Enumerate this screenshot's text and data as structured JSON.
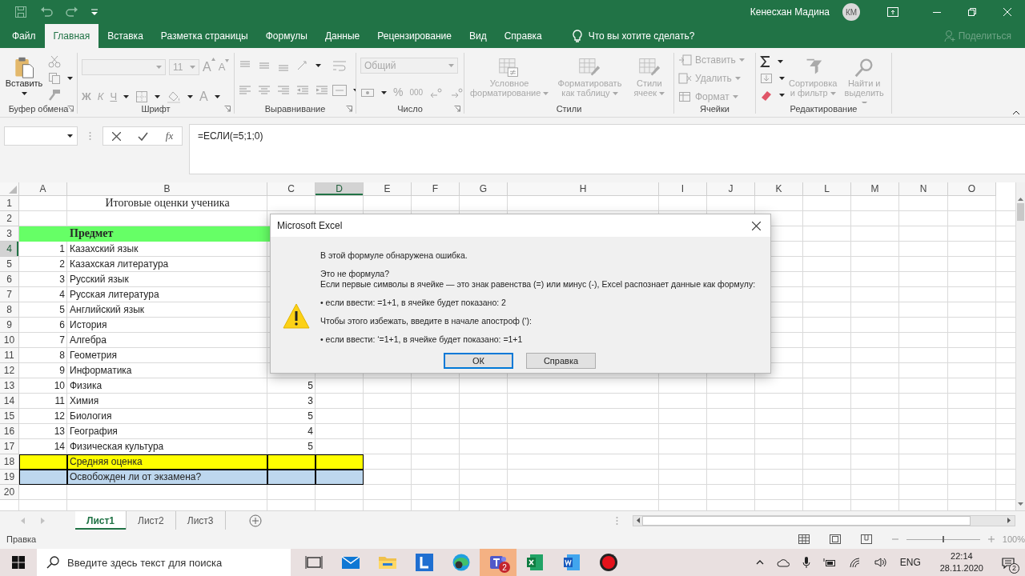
{
  "title_bar": {
    "user_name": "Кенесхан Мадина",
    "avatar": "КМ"
  },
  "ribbon_tabs": [
    {
      "label": "Файл",
      "selected": false
    },
    {
      "label": "Главная",
      "selected": true
    },
    {
      "label": "Вставка",
      "selected": false
    },
    {
      "label": "Разметка страницы",
      "selected": false
    },
    {
      "label": "Формулы",
      "selected": false
    },
    {
      "label": "Данные",
      "selected": false
    },
    {
      "label": "Рецензирование",
      "selected": false
    },
    {
      "label": "Вид",
      "selected": false
    },
    {
      "label": "Справка",
      "selected": false
    }
  ],
  "tell_me": "Что вы хотите сделать?",
  "share": {
    "label": "Поделиться",
    "disabled": true
  },
  "ribbon": {
    "clipboard": {
      "label": "Буфер обмена",
      "paste": {
        "label": "Вставить",
        "disabled": false
      }
    },
    "font": {
      "label": "Шрифт",
      "size": "11",
      "grow": "A",
      "shrink": "A",
      "styles": [
        "Ж",
        "К",
        "Ч"
      ],
      "font_color": "A"
    },
    "alignment": {
      "label": "Выравнивание"
    },
    "number": {
      "label": "Число",
      "format": "Общий",
      "percent": "%",
      "thousands": "000"
    },
    "styles": {
      "label": "Стили",
      "buttons": [
        {
          "label": "Условное форматирование",
          "disabled": true
        },
        {
          "label": "Форматировать как таблицу",
          "disabled": true
        },
        {
          "label": "Стили ячеек",
          "disabled": true
        }
      ]
    },
    "cells": {
      "label": "Ячейки",
      "buttons": [
        {
          "label": "Вставить",
          "disabled": true
        },
        {
          "label": "Удалить",
          "disabled": true
        },
        {
          "label": "Формат",
          "disabled": true
        }
      ]
    },
    "editing": {
      "label": "Редактирование",
      "buttons": [
        {
          "label": "Сортировка и фильтр",
          "disabled": true
        },
        {
          "label": "Найти и выделить",
          "disabled": true
        }
      ]
    }
  },
  "formula_bar": {
    "fx": "fx",
    "formula": "=ЕСЛИ(=5;1;0)"
  },
  "sheet": {
    "columns": [
      {
        "label": "A",
        "selected": false
      },
      {
        "label": "B",
        "selected": false
      },
      {
        "label": "C",
        "selected": false
      },
      {
        "label": "D",
        "selected": true
      },
      {
        "label": "E",
        "selected": false
      },
      {
        "label": "F",
        "selected": false
      },
      {
        "label": "G",
        "selected": false
      },
      {
        "label": "H",
        "selected": false
      },
      {
        "label": "I",
        "selected": false
      },
      {
        "label": "J",
        "selected": false
      },
      {
        "label": "K",
        "selected": false
      },
      {
        "label": "L",
        "selected": false
      },
      {
        "label": "M",
        "selected": false
      },
      {
        "label": "N",
        "selected": false
      },
      {
        "label": "O",
        "selected": false
      }
    ],
    "rows": [
      {
        "header": "1",
        "selected": false,
        "kind": "title",
        "cells": [
          "",
          "Итоговые оценки ученика"
        ]
      },
      {
        "header": "2",
        "selected": false,
        "kind": "item",
        "cells": []
      },
      {
        "header": "3",
        "selected": false,
        "kind": "heading",
        "color": "#66ff66",
        "cells": [
          "",
          "Предмет"
        ]
      },
      {
        "header": "4",
        "selected": true,
        "kind": "item",
        "cells": [
          "1",
          "Казахский язык"
        ]
      },
      {
        "header": "5",
        "selected": false,
        "kind": "item",
        "cells": [
          "2",
          "Казахская литература"
        ]
      },
      {
        "header": "6",
        "selected": false,
        "kind": "item",
        "cells": [
          "3",
          "Русский язык"
        ]
      },
      {
        "header": "7",
        "selected": false,
        "kind": "item",
        "cells": [
          "4",
          "Русская литература"
        ]
      },
      {
        "header": "8",
        "selected": false,
        "kind": "item",
        "cells": [
          "5",
          "Английский язык"
        ]
      },
      {
        "header": "9",
        "selected": false,
        "kind": "item",
        "cells": [
          "6",
          "История"
        ]
      },
      {
        "header": "10",
        "selected": false,
        "kind": "item",
        "cells": [
          "7",
          "Алгебра"
        ]
      },
      {
        "header": "11",
        "selected": false,
        "kind": "item",
        "cells": [
          "8",
          "Геометрия"
        ]
      },
      {
        "header": "12",
        "selected": false,
        "kind": "item",
        "cells": [
          "9",
          "Информатика"
        ]
      },
      {
        "header": "13",
        "selected": false,
        "kind": "item",
        "cells": [
          "10",
          "Физика",
          "5"
        ]
      },
      {
        "header": "14",
        "selected": false,
        "kind": "item",
        "cells": [
          "11",
          "Химия",
          "3"
        ]
      },
      {
        "header": "15",
        "selected": false,
        "kind": "item",
        "cells": [
          "12",
          "Биология",
          "5"
        ]
      },
      {
        "header": "16",
        "selected": false,
        "kind": "item",
        "cells": [
          "13",
          "География",
          "4"
        ]
      },
      {
        "header": "17",
        "selected": false,
        "kind": "item",
        "cells": [
          "14",
          "Физическая культура",
          "5"
        ]
      },
      {
        "header": "18",
        "selected": false,
        "kind": "boxed",
        "color": "#ffff00",
        "cells": [
          "",
          "Средняя оценка"
        ]
      },
      {
        "header": "19",
        "selected": false,
        "kind": "boxed",
        "color": "#bdd7ee",
        "cells": [
          "",
          "Освобожден ли от экзамена?"
        ]
      },
      {
        "header": "20",
        "selected": false,
        "kind": "item",
        "cells": []
      }
    ]
  },
  "sheet_tabs": [
    {
      "label": "Лист1",
      "selected": true
    },
    {
      "label": "Лист2",
      "selected": false
    },
    {
      "label": "Лист3",
      "selected": false
    }
  ],
  "status_bar": {
    "mode": "Правка",
    "zoom_slider": {
      "level": 0.5
    },
    "zoom": "100%"
  },
  "dialog": {
    "title": "Microsoft Excel",
    "paragraphs": [
      [
        "В этой формуле обнаружена ошибка."
      ],
      [
        "Это не формула?",
        "Если первые символы в ячейке — это знак равенства (=) или минус (-), Excel распознает данные как формулу:"
      ],
      [
        "• если ввести: =1+1, в ячейке будет показано: 2"
      ],
      [
        "Чтобы этого избежать, введите в начале апостроф (‘):"
      ],
      [
        "• если ввести: ‘=1+1, в ячейке будет показано: =1+1"
      ]
    ],
    "buttons": [
      {
        "label": "ОК",
        "selected": true
      },
      {
        "label": "Справка",
        "selected": false
      }
    ]
  },
  "taskbar": {
    "search_placeholder": "Введите здесь текст для поиска",
    "teams_badge": "2",
    "language": "ENG",
    "time": "22:14",
    "date": "28.11.2020",
    "notification_count": "2"
  }
}
